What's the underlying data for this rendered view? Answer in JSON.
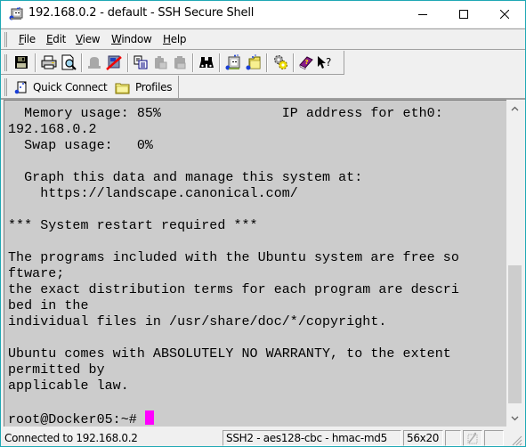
{
  "window": {
    "title": "192.168.0.2 - default - SSH Secure Shell",
    "controls": {
      "minimize": "minimize",
      "maximize": "maximize",
      "close": "close"
    }
  },
  "menubar": {
    "items": [
      {
        "label": "File",
        "accel": "F",
        "rest": "ile"
      },
      {
        "label": "Edit",
        "accel": "E",
        "rest": "dit"
      },
      {
        "label": "View",
        "accel": "V",
        "rest": "iew"
      },
      {
        "label": "Window",
        "accel": "W",
        "rest": "indow"
      },
      {
        "label": "Help",
        "accel": "H",
        "rest": "elp"
      }
    ]
  },
  "toolbar": {
    "buttons": [
      {
        "name": "save",
        "icon": "floppy-disk-icon",
        "enabled": true
      },
      {
        "name": "print",
        "icon": "printer-icon",
        "enabled": true
      },
      {
        "name": "print-preview",
        "icon": "print-preview-icon",
        "enabled": true
      },
      {
        "name": "connect",
        "icon": "connect-icon",
        "enabled": false
      },
      {
        "name": "disconnect",
        "icon": "disconnect-icon",
        "enabled": true
      },
      {
        "name": "copy",
        "icon": "copy-icon",
        "enabled": true
      },
      {
        "name": "paste",
        "icon": "paste-icon",
        "enabled": false
      },
      {
        "name": "paste-special",
        "icon": "paste-special-icon",
        "enabled": false
      },
      {
        "name": "find",
        "icon": "binoculars-icon",
        "enabled": true
      },
      {
        "name": "new-terminal",
        "icon": "new-terminal-window-icon",
        "enabled": true
      },
      {
        "name": "new-file-transfer",
        "icon": "new-file-transfer-window-icon",
        "enabled": true
      },
      {
        "name": "settings",
        "icon": "settings-gear-icon",
        "enabled": true
      },
      {
        "name": "help",
        "icon": "help-book-icon",
        "enabled": true
      },
      {
        "name": "context-help",
        "icon": "whats-this-icon",
        "enabled": true
      }
    ]
  },
  "quickbar": {
    "quick_connect": "Quick Connect",
    "profiles": "Profiles"
  },
  "terminal": {
    "lines": [
      "  Memory usage: 85%               IP address for eth0:",
      "192.168.0.2",
      "  Swap usage:   0%",
      "",
      "  Graph this data and manage this system at:",
      "    https://landscape.canonical.com/",
      "",
      "*** System restart required ***",
      "",
      "The programs included with the Ubuntu system are free so",
      "ftware;",
      "the exact distribution terms for each program are descri",
      "bed in the",
      "individual files in /usr/share/doc/*/copyright.",
      "",
      "Ubuntu comes with ABSOLUTELY NO WARRANTY, to the extent",
      "permitted by",
      "applicable law.",
      ""
    ],
    "prompt": "root@Docker05:~# ",
    "cursor_color": "#ff00ff",
    "background_color": "#cccccc"
  },
  "scrollbar": {
    "position_fraction": 0.51,
    "visible_fraction": 0.47
  },
  "statusbar": {
    "connection": "Connected to 192.168.0.2",
    "encryption": "SSH2 - aes128-cbc - hmac-md5",
    "size": "56x20"
  },
  "colors": {
    "window_border": "#1fa8b4",
    "chrome": "#f0f0f0",
    "terminal_bg": "#cccccc",
    "cursor": "#ff00ff"
  }
}
